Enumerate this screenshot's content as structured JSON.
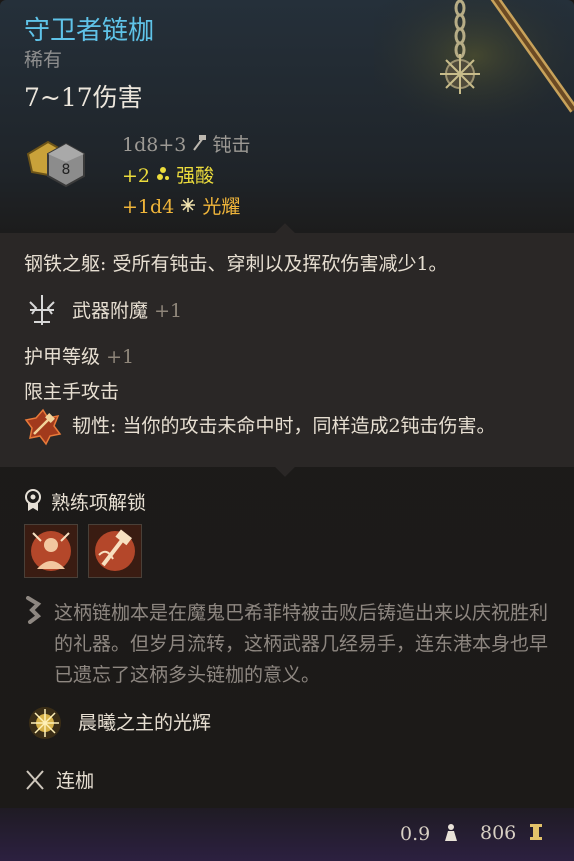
{
  "item": {
    "name": "守卫者链枷",
    "rarity": "稀有",
    "damage_summary": "7~17伤害",
    "dice_label": "8",
    "damage_lines": {
      "base": "1d8+3",
      "base_type": "钝击",
      "bonus1_value": "+2",
      "bonus1_type": "强酸",
      "bonus2_value": "+1d4",
      "bonus2_type": "光耀"
    }
  },
  "properties": {
    "passive_name": "钢铁之躯:",
    "passive_text": "受所有钝击、穿刺以及挥砍伤害减少1。",
    "enchant_label": "武器附魔",
    "enchant_value": "+1",
    "armor_label": "护甲等级",
    "armor_value": "+1",
    "mainhand_only": "限主手攻击",
    "toughness_name": "韧性:",
    "toughness_text": "当你的攻击未命中时，同样造成2钝击伤害。"
  },
  "proficiency": {
    "title": "熟练项解锁"
  },
  "lore": "这柄链枷本是在魔鬼巴希菲特被击败后铸造出来以庆祝胜利的礼器。但岁月流转，这柄武器几经易手，连东港本身也早已遗忘了这柄多头链枷的意义。",
  "aura": "晨曦之主的光辉",
  "weapon_type": "连枷",
  "footer": {
    "weight": "0.9",
    "price": "806"
  },
  "colors": {
    "title": "#5fc3e8",
    "acid": "#ecdc3c",
    "radiant": "#f0b53a"
  },
  "icons": [
    "weapon-art",
    "dice-icon",
    "bludgeon-icon",
    "acid-icon",
    "radiant-icon",
    "enchant-icon",
    "toughness-icon",
    "proficiency-icon",
    "skill-icon-1",
    "skill-icon-2",
    "lore-icon",
    "aura-icon",
    "weapon-type-icon",
    "weight-icon",
    "gold-icon"
  ]
}
